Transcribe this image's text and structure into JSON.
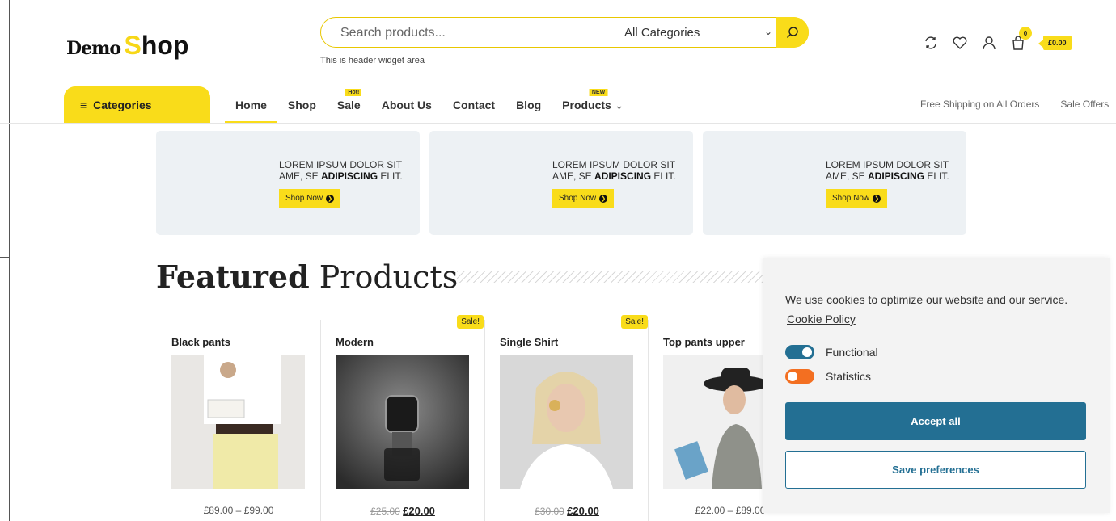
{
  "logo": {
    "part1": "Demo",
    "part2_s": "S",
    "part2_rest": "hop"
  },
  "search": {
    "placeholder": "Search products...",
    "category": "All Categories",
    "widget_note": "This is header widget area"
  },
  "header": {
    "cart_count": "0",
    "cart_total": "£0.00"
  },
  "nav": {
    "categories_label": "Categories",
    "items": [
      {
        "label": "Home",
        "tag": ""
      },
      {
        "label": "Shop",
        "tag": ""
      },
      {
        "label": "Sale",
        "tag": "Hot!"
      },
      {
        "label": "About Us",
        "tag": ""
      },
      {
        "label": "Contact",
        "tag": ""
      },
      {
        "label": "Blog",
        "tag": ""
      },
      {
        "label": "Products",
        "tag": "NEW"
      }
    ],
    "right_links": [
      "Free Shipping on All Orders",
      "Sale Offers"
    ]
  },
  "banners": [
    {
      "line1": "LOREM IPSUM DOLOR SIT",
      "line2a": "AME, SE ",
      "line2b": "ADIPISCING",
      "line2c": " ELIT.",
      "button": "Shop Now"
    },
    {
      "line1": "LOREM IPSUM DOLOR SIT",
      "line2a": "AME, SE ",
      "line2b": "ADIPISCING",
      "line2c": " ELIT.",
      "button": "Shop Now"
    },
    {
      "line1": "LOREM IPSUM DOLOR SIT",
      "line2a": "AME, SE ",
      "line2b": "ADIPISCING",
      "line2c": " ELIT.",
      "button": "Shop Now"
    }
  ],
  "featured": {
    "title_bold": "Featured",
    "title_rest": " Products"
  },
  "products": [
    {
      "name": "Black pants",
      "sale": "",
      "price_old": "",
      "price": "£89.00 – £99.00"
    },
    {
      "name": "Modern",
      "sale": "Sale!",
      "price_old": "£25.00",
      "price": "£20.00"
    },
    {
      "name": "Single Shirt",
      "sale": "Sale!",
      "price_old": "£30.00",
      "price": "£20.00"
    },
    {
      "name": "Top pants upper",
      "sale": "",
      "price_old": "",
      "price": "£22.00 – £89.00"
    }
  ],
  "hidden_price": "£20.00",
  "cookie": {
    "message": "We use cookies to optimize our website and our service.",
    "policy_link": "Cookie Policy",
    "toggles": [
      {
        "label": "Functional",
        "color": "#236f93",
        "on": true
      },
      {
        "label": "Statistics",
        "color": "#f36f21",
        "on": false
      }
    ],
    "accept_label": "Accept all",
    "save_label": "Save preferences"
  },
  "colors": {
    "accent": "#f9dc1a",
    "cookie_blue": "#236f93",
    "toggle_orange": "#f36f21"
  }
}
